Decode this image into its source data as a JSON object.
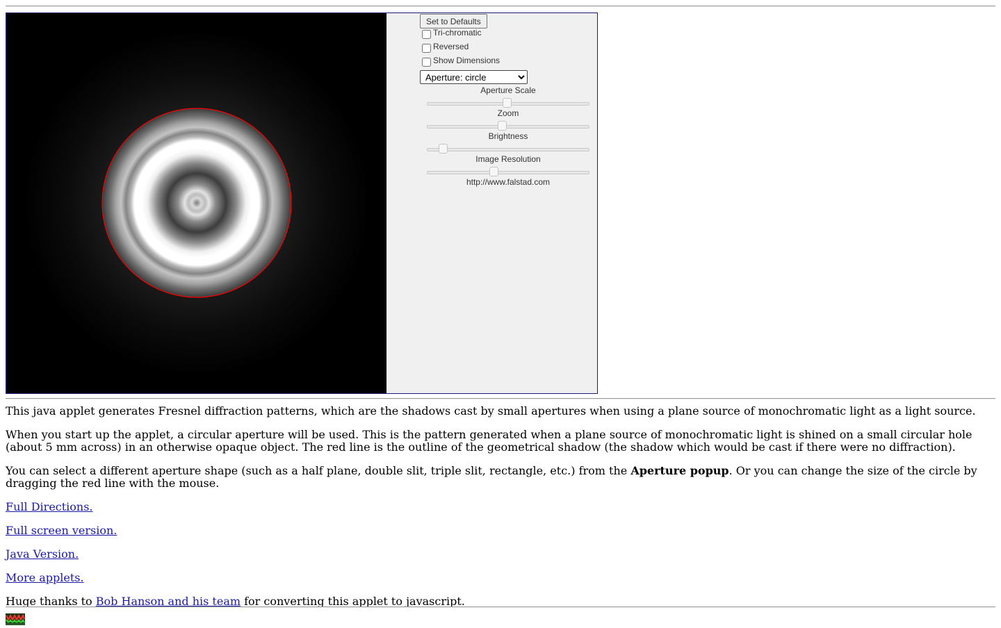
{
  "applet": {
    "defaults_button": "Set to Defaults",
    "checkboxes": [
      {
        "label": "Tri-chromatic",
        "checked": false
      },
      {
        "label": "Reversed",
        "checked": false
      },
      {
        "label": "Show Dimensions",
        "checked": false
      }
    ],
    "aperture_select": {
      "selected": "Aperture: circle"
    },
    "sliders": [
      {
        "label": "Aperture Scale",
        "position": 0.49
      },
      {
        "label": "Zoom",
        "position": 0.46
      },
      {
        "label": "Brightness",
        "position": 0.1
      },
      {
        "label": "Image Resolution",
        "position": 0.41
      }
    ],
    "url_text": "http://www.falstad.com",
    "colors": {
      "shadow_outline": "#ff0000",
      "canvas_background": "#000000",
      "panel_background": "#f0f0f0"
    }
  },
  "content": {
    "para1": "This java applet generates Fresnel diffraction patterns, which are the shadows cast by small apertures when using a plane source of monochromatic light as a light source.",
    "para2": "When you start up the applet, a circular aperture will be used. This is the pattern generated when a plane source of monochromatic light is shined on a small circular hole (about 5 mm across) in an otherwise opaque object. The red line is the outline of the geometrical shadow (the shadow which would be cast if there were no diffraction).",
    "para3_before": "You can select a different aperture shape (such as a half plane, double slit, triple slit, rectangle, etc.) from the ",
    "para3_bold": "Aperture popup",
    "para3_after": ". Or you can change the size of the circle by dragging the red line with the mouse.",
    "links": {
      "full_directions": "Full Directions.",
      "full_screen": "Full screen version.",
      "java_version": "Java Version.",
      "more_applets": "More applets."
    },
    "thanks_before": "Huge thanks to ",
    "thanks_link": "Bob Hanson and his team",
    "thanks_after": " for converting this applet to javascript."
  },
  "footer": {
    "logo_icon": "falstad-logo-icon"
  }
}
